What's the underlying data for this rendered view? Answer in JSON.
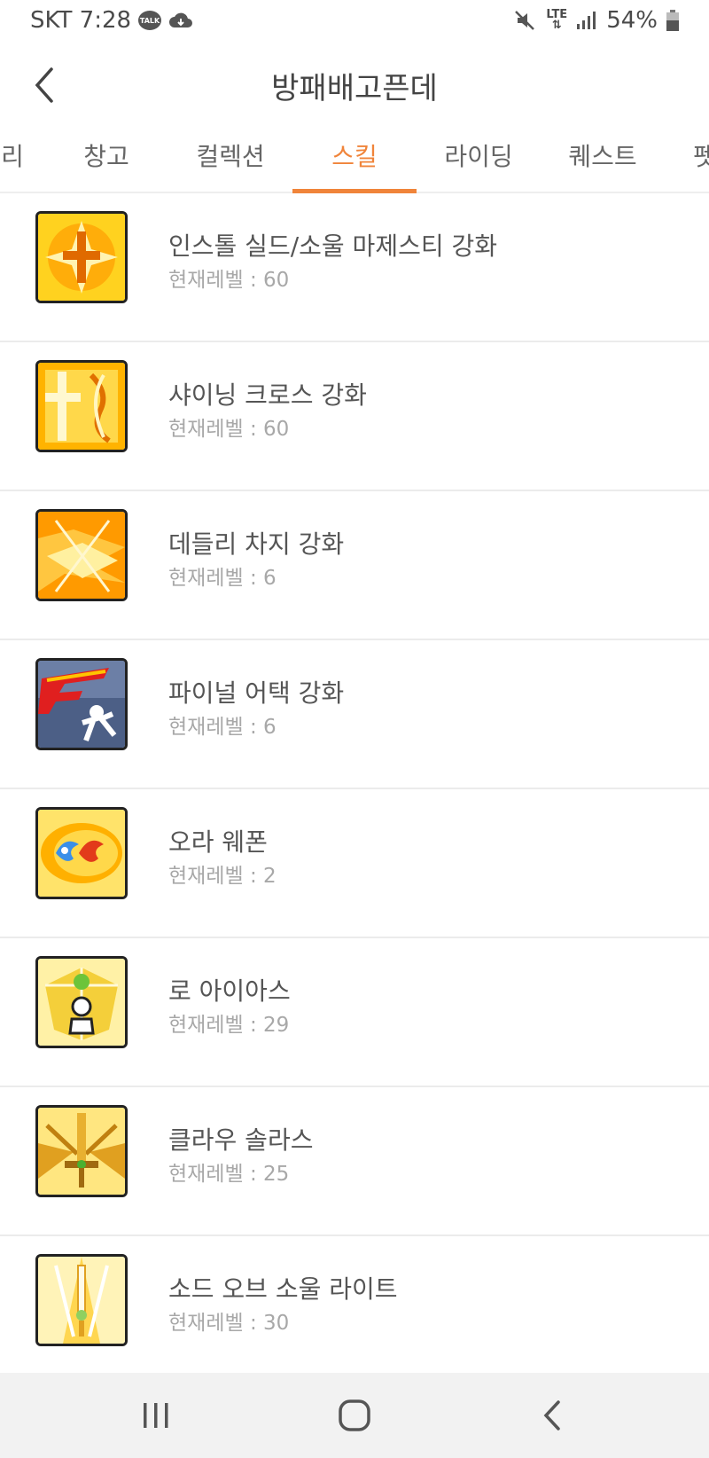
{
  "status": {
    "carrier_time": "SKT 7:28",
    "talk_label": "TALK",
    "network": "LTE",
    "battery": "54%"
  },
  "header": {
    "title": "방패배고픈데"
  },
  "tabs": [
    {
      "label": "리"
    },
    {
      "label": "창고"
    },
    {
      "label": "컬렉션"
    },
    {
      "label": "스킬",
      "active": true
    },
    {
      "label": "라이딩"
    },
    {
      "label": "퀘스트"
    },
    {
      "label": "펫"
    }
  ],
  "skills": [
    {
      "name": "인스톨 실드/소울 마제스티 강화",
      "level": "현재레벨 : 60",
      "icon": "install-shield-icon"
    },
    {
      "name": "샤이닝 크로스 강화",
      "level": "현재레벨 : 60",
      "icon": "shining-cross-icon"
    },
    {
      "name": "데들리 차지 강화",
      "level": "현재레벨 : 6",
      "icon": "deadly-charge-icon"
    },
    {
      "name": "파이널 어택 강화",
      "level": "현재레벨 : 6",
      "icon": "final-attack-icon"
    },
    {
      "name": "오라 웨폰",
      "level": "현재레벨 : 2",
      "icon": "aura-weapon-icon"
    },
    {
      "name": "로 아이아스",
      "level": "현재레벨 : 29",
      "icon": "ro-aias-icon"
    },
    {
      "name": "클라우 솔라스",
      "level": "현재레벨 : 25",
      "icon": "claiomh-solais-icon"
    },
    {
      "name": "소드 오브 소울 라이트",
      "level": "현재레벨 : 30",
      "icon": "sword-of-soul-light-icon"
    }
  ],
  "colors": {
    "accent": "#f0843a"
  }
}
